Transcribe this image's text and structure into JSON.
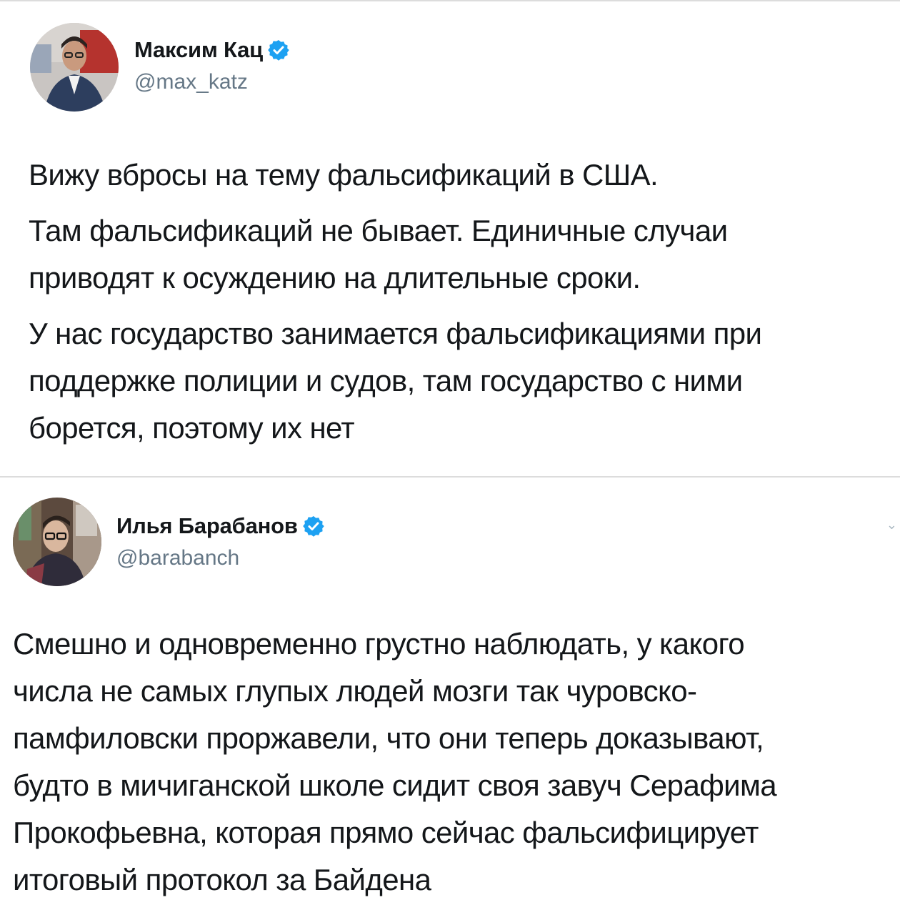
{
  "tweets": [
    {
      "author": {
        "name": "Максим Кац",
        "handle": "@max_katz",
        "verified": true
      },
      "paragraphs": [
        [
          "Вижу вбросы на тему фальсификаций в США."
        ],
        [
          "Там фальсификаций не бывает. Единичные случаи",
          "приводят к осуждению на длительные сроки."
        ],
        [
          "У нас государство занимается фальсификациями при",
          "поддержке полиции и судов, там государство с ними",
          "борется, поэтому их нет"
        ]
      ]
    },
    {
      "author": {
        "name": "Илья Барабанов",
        "handle": "@barabanch",
        "verified": true
      },
      "paragraphs": [
        [
          "Смешно и одновременно грустно наблюдать, у какого",
          "числа не самых глупых людей мозги так чуровско-",
          "памфиловски проржавели, что они теперь доказывают,",
          "будто в мичиганской школе сидит своя завуч Серафима",
          "Прокофьевна, которая прямо сейчас фальсифицирует",
          "итоговый протокол за Байдена"
        ]
      ]
    }
  ],
  "colors": {
    "verified_badge": "#1da1f2",
    "handle": "#657786",
    "text": "#14171a",
    "divider": "#dcdcdc"
  },
  "icons": {
    "verified": "verified-badge-icon"
  }
}
